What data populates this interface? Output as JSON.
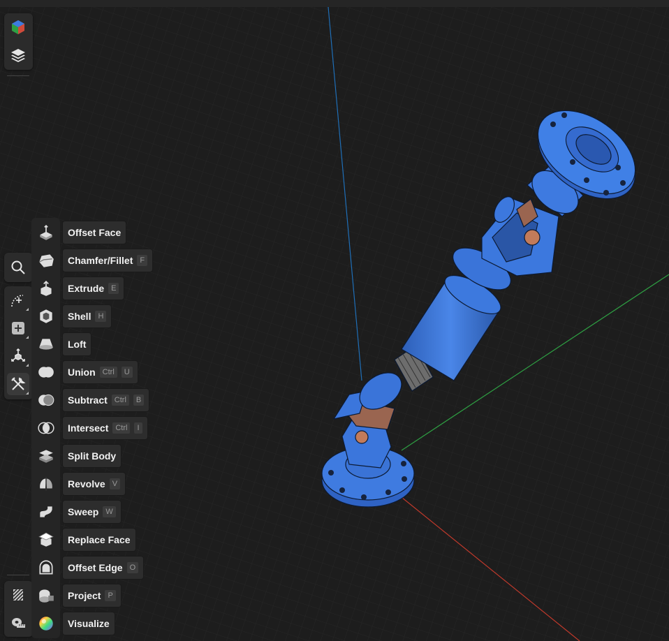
{
  "viewport": {
    "background": "#1d1d1d",
    "axis_colors": {
      "x": "#c0392b",
      "y": "#2ea043",
      "z": "#1f6fb8"
    },
    "model_color": "#3a74d9",
    "accent_color": "#c27b5a"
  },
  "top_toolbar": [
    {
      "icon": "cube-icon"
    },
    {
      "icon": "layers-icon"
    }
  ],
  "left_toolbar": [
    {
      "icon": "search-icon"
    },
    {
      "icon": "sketch-icon"
    },
    {
      "icon": "add-primitive-icon"
    },
    {
      "icon": "transform-icon"
    },
    {
      "icon": "tools-icon",
      "active": true
    }
  ],
  "bottom_toolbar": [
    {
      "icon": "section-view-icon"
    },
    {
      "icon": "measure-icon"
    }
  ],
  "tools_menu": {
    "items": [
      {
        "label": "Offset Face",
        "shortcut": []
      },
      {
        "label": "Chamfer/Fillet",
        "shortcut": [
          "F"
        ]
      },
      {
        "label": "Extrude",
        "shortcut": [
          "E"
        ]
      },
      {
        "label": "Shell",
        "shortcut": [
          "H"
        ]
      },
      {
        "label": "Loft",
        "shortcut": []
      },
      {
        "label": "Union",
        "shortcut": [
          "Ctrl",
          "U"
        ]
      },
      {
        "label": "Subtract",
        "shortcut": [
          "Ctrl",
          "B"
        ]
      },
      {
        "label": "Intersect",
        "shortcut": [
          "Ctrl",
          "I"
        ]
      },
      {
        "label": "Split Body",
        "shortcut": []
      },
      {
        "label": "Revolve",
        "shortcut": [
          "V"
        ]
      },
      {
        "label": "Sweep",
        "shortcut": [
          "W"
        ]
      },
      {
        "label": "Replace Face",
        "shortcut": []
      },
      {
        "label": "Offset Edge",
        "shortcut": [
          "O"
        ]
      },
      {
        "label": "Project",
        "shortcut": [
          "P"
        ]
      },
      {
        "label": "Visualize",
        "shortcut": []
      }
    ]
  }
}
